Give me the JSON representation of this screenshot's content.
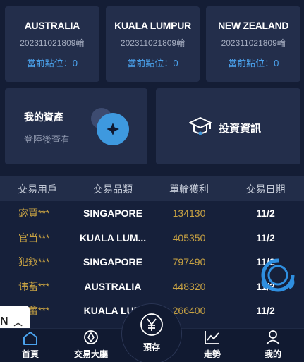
{
  "markets": [
    {
      "name": "AUSTRALIA",
      "code": "202311021809輪",
      "point_label": "當前點位：0"
    },
    {
      "name": "KUALA LUMPUR",
      "code": "202311021809輪",
      "point_label": "當前點位：0"
    },
    {
      "name": "NEW ZEALAND",
      "code": "202311021809輪",
      "point_label": "當前點位：0"
    }
  ],
  "asset": {
    "title": "我的資產",
    "subtitle": "登陸後查看"
  },
  "invest": {
    "label": "投資資訊"
  },
  "table": {
    "headers": [
      "交易用戶",
      "交易品類",
      "單輪獲利",
      "交易日期"
    ],
    "rows": [
      {
        "user": "宓賈***",
        "product": "SINGAPORE",
        "profit": "134130",
        "date": "11/2"
      },
      {
        "user": "官当***",
        "product": "KUALA LUM...",
        "profit": "405350",
        "date": "11/2"
      },
      {
        "user": "犯釵***",
        "product": "SINGAPORE",
        "profit": "797490",
        "date": "11/2"
      },
      {
        "user": "讳蓄***",
        "product": "AUSTRALIA",
        "profit": "448320",
        "date": "11/2"
      },
      {
        "user": "迷畲***",
        "product": "KUALA LUM",
        "profit": "266400",
        "date": "11/2"
      }
    ]
  },
  "float_tab": {
    "label": "N"
  },
  "nav": {
    "home": "首頁",
    "hall": "交易大廳",
    "deposit": "預存",
    "trend": "走勢",
    "me": "我的"
  },
  "colors": {
    "accent_blue": "#4ba3ee",
    "gold": "#c9a343",
    "bg": "#16203a",
    "card": "#232e4b"
  }
}
